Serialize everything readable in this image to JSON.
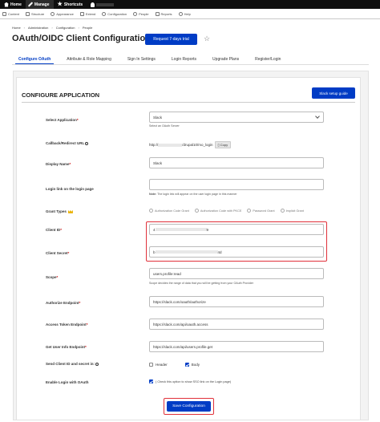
{
  "toolbar": {
    "items": [
      {
        "label": "Home",
        "icon": "home-icon"
      },
      {
        "label": "Manage",
        "icon": "wrench-icon"
      },
      {
        "label": "Shortcuts",
        "icon": "star-icon"
      },
      {
        "label": "",
        "icon": "user-icon"
      }
    ]
  },
  "admin_menu": {
    "items": [
      "Content",
      "Structure",
      "Appearance",
      "Extend",
      "Configuration",
      "People",
      "Reports",
      "Help"
    ]
  },
  "breadcrumb": [
    "Home",
    "Administration",
    "Configuration",
    "People"
  ],
  "page": {
    "title": "OAuth/OIDC Client Configuration",
    "trial_button": "Request 7-days trial"
  },
  "tabs": [
    "Configure OAuth",
    "Attribute & Role Mapping",
    "Sign In Settings",
    "Login Reports",
    "Upgrade Plans",
    "Register/Login"
  ],
  "section": {
    "title": "CONFIGURE APPLICATION",
    "setup_button": "Slack setup guide"
  },
  "form": {
    "select_application": {
      "label": "Select Application",
      "value": "Slack",
      "desc": "Select an OAuth Server"
    },
    "callback_url": {
      "label": "Callback/Redirect URL",
      "prefix": "http://",
      "suffix": "/drupal10/mo_login",
      "copy_label": "Copy"
    },
    "display_name": {
      "label": "Display Name",
      "value": "Slack"
    },
    "login_link": {
      "label": "Login link on the login page",
      "value": "",
      "note_bold": "Note:",
      "note": " The login link will appear on the user login page in this manner"
    },
    "grant_types": {
      "label": "Grant Types",
      "options": [
        "Authorization Code Grant",
        "Authorization Code with PKCE",
        "Password Grant",
        "Implicit Grant"
      ]
    },
    "client_id": {
      "label": "Client ID",
      "value_start": "4",
      "value_end": "9"
    },
    "client_secret": {
      "label": "Client Secret",
      "value_start": "b",
      "value_end": "4d"
    },
    "scope": {
      "label": "Scope",
      "value": "users.profile:read",
      "desc": "Scope decides the range of data that you will be getting from your OAuth Provider"
    },
    "authorize_endpoint": {
      "label": "Authorize Endpoint",
      "value": "https://slack.com/oauth/authorize"
    },
    "access_token_endpoint": {
      "label": "Access Token Endpoint",
      "value": "https://slack.com/api/oauth.access"
    },
    "user_info_endpoint": {
      "label": "Get User Info Endpoint",
      "value": "https://slack.com/api/users.profile.get"
    },
    "send_client": {
      "label": "Send Client ID and secret in:",
      "header_label": "Header",
      "body_label": "Body",
      "header_checked": false,
      "body_checked": true
    },
    "enable_login": {
      "label": "Enable Login with OAuth",
      "desc": "( Check this option to show SSO link on the Login page)",
      "checked": true
    },
    "save_button": "Save Configuration"
  },
  "colors": {
    "accent": "#003cc5",
    "highlight": "#e0313a",
    "required": "#cc0000"
  }
}
